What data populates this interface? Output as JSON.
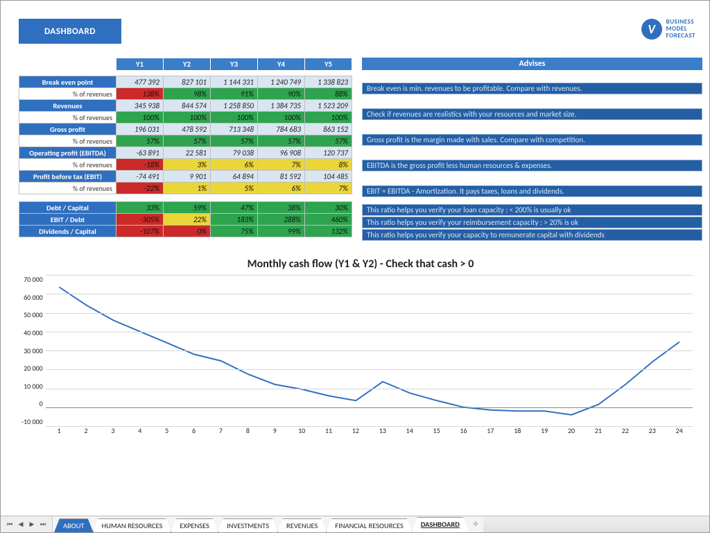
{
  "header": {
    "title": "DASHBOARD",
    "logo_line1": "BUSINESS",
    "logo_line2": "MODEL",
    "logo_line3": "FORECAST",
    "logo_glyph": "V"
  },
  "years": [
    "Y1",
    "Y2",
    "Y3",
    "Y4",
    "Y5"
  ],
  "advises_header": "Advises",
  "table1": [
    {
      "label": "Break even point",
      "vals": [
        "477 392",
        "827 101",
        "1 144 331",
        "1 240 749",
        "1 338 823"
      ],
      "advise": "Break even is min. revenues to be profitable. Compare with revenues."
    },
    {
      "label": "% of revenues",
      "sub": true,
      "pcts": [
        {
          "v": "138%",
          "c": "r"
        },
        {
          "v": "98%",
          "c": "g"
        },
        {
          "v": "91%",
          "c": "g"
        },
        {
          "v": "90%",
          "c": "g"
        },
        {
          "v": "88%",
          "c": "g"
        }
      ]
    },
    {
      "label": "Revenues",
      "vals": [
        "345 938",
        "844 574",
        "1 258 850",
        "1 384 735",
        "1 523 209"
      ],
      "advise": "Check if revenues are realistics with your resources and market size."
    },
    {
      "label": "% of revenues",
      "sub": true,
      "pcts": [
        {
          "v": "100%",
          "c": "g"
        },
        {
          "v": "100%",
          "c": "g"
        },
        {
          "v": "100%",
          "c": "g"
        },
        {
          "v": "100%",
          "c": "g"
        },
        {
          "v": "100%",
          "c": "g"
        }
      ]
    },
    {
      "label": "Gross profit",
      "vals": [
        "196 031",
        "478 592",
        "713 348",
        "784 683",
        "863 152"
      ],
      "advise": "Gross profit is the margin made with sales. Compare with competition."
    },
    {
      "label": "% of revenues",
      "sub": true,
      "pcts": [
        {
          "v": "57%",
          "c": "g"
        },
        {
          "v": "57%",
          "c": "g"
        },
        {
          "v": "57%",
          "c": "g"
        },
        {
          "v": "57%",
          "c": "g"
        },
        {
          "v": "57%",
          "c": "g"
        }
      ]
    },
    {
      "label": "Operating profit (EBITDA)",
      "vals": [
        "-63 891",
        "22 581",
        "79 038",
        "96 908",
        "120 737"
      ],
      "advise": "EBITDA is the gross profit less human resources & expenses."
    },
    {
      "label": "% of revenues",
      "sub": true,
      "pcts": [
        {
          "v": "-18%",
          "c": "r"
        },
        {
          "v": "3%",
          "c": "y"
        },
        {
          "v": "6%",
          "c": "y"
        },
        {
          "v": "7%",
          "c": "y"
        },
        {
          "v": "8%",
          "c": "y"
        }
      ]
    },
    {
      "label": "Profit before tax (EBIT)",
      "vals": [
        "-74 491",
        "9 901",
        "64 894",
        "81 592",
        "104 485"
      ],
      "advise": "EBIT = EBITDA - Amortization. It pays taxes, loans and dividends."
    },
    {
      "label": "% of revenues",
      "sub": true,
      "pcts": [
        {
          "v": "-22%",
          "c": "r"
        },
        {
          "v": "1%",
          "c": "y"
        },
        {
          "v": "5%",
          "c": "y"
        },
        {
          "v": "6%",
          "c": "y"
        },
        {
          "v": "7%",
          "c": "y"
        }
      ]
    }
  ],
  "table2": [
    {
      "label": "Debt / Capital",
      "pcts": [
        {
          "v": "33%",
          "c": "g"
        },
        {
          "v": "59%",
          "c": "g"
        },
        {
          "v": "47%",
          "c": "g"
        },
        {
          "v": "38%",
          "c": "g"
        },
        {
          "v": "30%",
          "c": "g"
        }
      ],
      "advise": "This ratio helps you verify your loan capacity : < 200% is usually ok"
    },
    {
      "label": "EBIT / Debt",
      "pcts": [
        {
          "v": "-305%",
          "c": "r"
        },
        {
          "v": "22%",
          "c": "y"
        },
        {
          "v": "183%",
          "c": "g"
        },
        {
          "v": "288%",
          "c": "g"
        },
        {
          "v": "460%",
          "c": "g"
        }
      ],
      "advise": "This ratio helps you verify your reimbursement capacity : > 20% is ok"
    },
    {
      "label": "Dividends / Capital",
      "pcts": [
        {
          "v": "-107%",
          "c": "r"
        },
        {
          "v": "0%",
          "c": "r"
        },
        {
          "v": "75%",
          "c": "g"
        },
        {
          "v": "99%",
          "c": "g"
        },
        {
          "v": "132%",
          "c": "g"
        }
      ],
      "advise": "This ratio helps you verify your capacity to remunerate capital with dividends"
    }
  ],
  "chart_data": {
    "type": "line",
    "title": "Monthly cash flow (Y1 & Y2) - Check that cash > 0",
    "xlabel": "",
    "ylabel": "",
    "ylim": [
      -10000,
      70000
    ],
    "yticks": [
      -10000,
      0,
      10000,
      20000,
      30000,
      40000,
      50000,
      60000,
      70000
    ],
    "ytick_labels": [
      "-10 000",
      "0",
      "10 000",
      "20 000",
      "30 000",
      "40 000",
      "50 000",
      "60 000",
      "70 000"
    ],
    "x": [
      1,
      2,
      3,
      4,
      5,
      6,
      7,
      8,
      9,
      10,
      11,
      12,
      13,
      14,
      15,
      16,
      17,
      18,
      19,
      20,
      21,
      22,
      23,
      24
    ],
    "values": [
      63500,
      54000,
      46000,
      40000,
      34000,
      28000,
      24500,
      17500,
      12000,
      9500,
      6000,
      3500,
      13500,
      7500,
      3500,
      0,
      -1500,
      -2000,
      -2000,
      -4000,
      1500,
      12000,
      24000,
      34500
    ]
  },
  "tabs": {
    "items": [
      "ABOUT",
      "HUMAN RESOURCES",
      "EXPENSES",
      "INVESTMENTS",
      "REVENUES",
      "FINANCIAL RESOURCES",
      "DASHBOARD"
    ],
    "active": "DASHBOARD"
  }
}
